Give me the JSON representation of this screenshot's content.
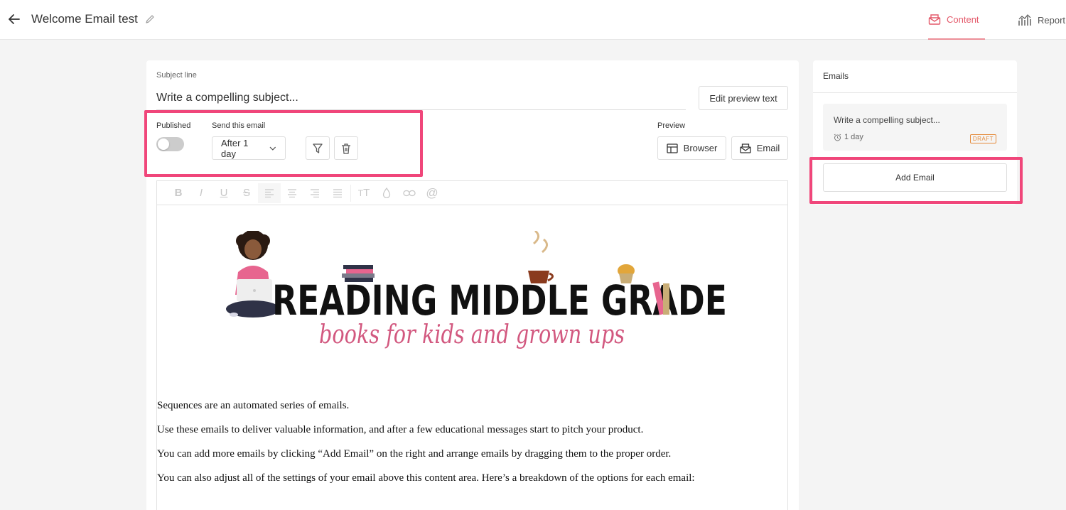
{
  "header": {
    "title": "Welcome Email test",
    "tabs": [
      {
        "label": "Content",
        "icon": "envelope-icon",
        "active": true
      },
      {
        "label": "Report",
        "icon": "chart-icon",
        "active": false
      }
    ]
  },
  "editor": {
    "subject_label": "Subject line",
    "subject_placeholder": "Write a compelling subject...",
    "edit_preview_label": "Edit preview text",
    "published_label": "Published",
    "published": false,
    "send_label": "Send this email",
    "send_value": "After 1 day",
    "preview_label": "Preview",
    "browser_label": "Browser",
    "email_label": "Email",
    "toolbar": [
      "bold",
      "italic",
      "underline",
      "strikethrough",
      "align-left",
      "align-center",
      "align-right",
      "align-justify",
      "font-size",
      "color",
      "link",
      "mention"
    ],
    "logo_title": "READING MIDDLE GRADE",
    "logo_tagline": "books for kids and grown ups",
    "paragraphs": [
      "Sequences are an automated series of emails.",
      "Use these emails to deliver valuable information, and after a few educational messages start to pitch your product.",
      "You can add more emails by clicking “Add Email” on the right and arrange emails by dragging them to the proper order.",
      "You can also adjust all of the settings of your email above this content area. Here’s a breakdown of the options for each email:"
    ]
  },
  "sidebar": {
    "title": "Emails",
    "items": [
      {
        "subject": "Write a compelling subject...",
        "delay": "1 day",
        "status": "DRAFT"
      }
    ],
    "add_label": "Add Email"
  },
  "colors": {
    "accent": "#e4596a",
    "highlight": "#f0467a",
    "draft": "#e58a3a"
  }
}
